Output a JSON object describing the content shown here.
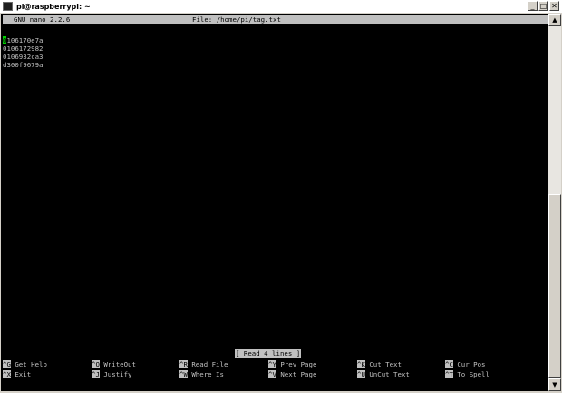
{
  "window": {
    "title": "pi@raspberrypi: ~",
    "buttons": {
      "minimize": "_",
      "maximize": "□",
      "close": "✕"
    }
  },
  "nano": {
    "version": "GNU nano 2.2.6",
    "file": "File: /home/pi/tag.txt"
  },
  "buffer": {
    "cursor_char": "0",
    "line1_rest": "106170e7a",
    "lines": [
      "0106172982",
      "0106932ca3",
      "d300f9679a"
    ]
  },
  "status": "[ Read 4 lines ]",
  "shortcuts": {
    "row1": [
      {
        "key": "^G",
        "label": "Get Help"
      },
      {
        "key": "^O",
        "label": "WriteOut"
      },
      {
        "key": "^R",
        "label": "Read File"
      },
      {
        "key": "^Y",
        "label": "Prev Page"
      },
      {
        "key": "^K",
        "label": "Cut Text"
      },
      {
        "key": "^C",
        "label": "Cur Pos"
      }
    ],
    "row2": [
      {
        "key": "^X",
        "label": "Exit"
      },
      {
        "key": "^J",
        "label": "Justify"
      },
      {
        "key": "^W",
        "label": "Where Is"
      },
      {
        "key": "^V",
        "label": "Next Page"
      },
      {
        "key": "^U",
        "label": "UnCut Text"
      },
      {
        "key": "^T",
        "label": "To Spell"
      }
    ]
  },
  "colors": {
    "terminal_bg": "#000000",
    "terminal_fg": "#c0c0c0",
    "cursor": "#00d000",
    "inverse_bg": "#c0c0c0"
  },
  "scrollbar": {
    "up": "▲",
    "down": "▼"
  }
}
